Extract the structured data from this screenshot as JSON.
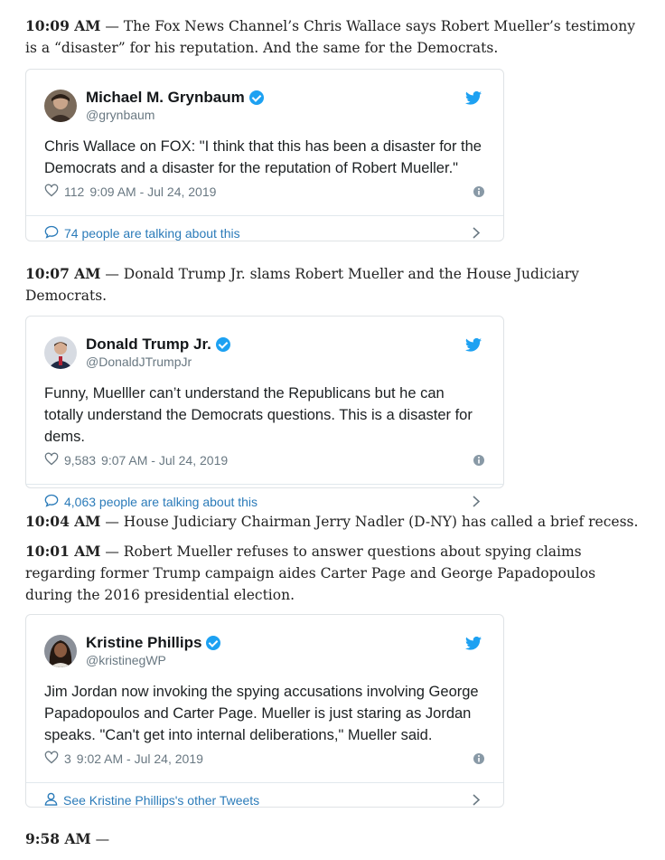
{
  "updates": [
    {
      "time": "10:09 AM",
      "text": " — The Fox News Channel’s Chris Wallace says Robert Mueller’s testimony is a “disaster” for his reputation. And the same for the Democrats."
    },
    {
      "time": "10:07 AM",
      "text": " — Donald Trump Jr. slams Robert Mueller and the House Judiciary Democrats."
    },
    {
      "time": "10:04 AM",
      "text": " — House Judiciary Chairman Jerry Nadler (D-NY) has called a brief recess."
    },
    {
      "time": "10:01 AM",
      "text": " — Robert Mueller refuses to answer questions about spying claims regarding former Trump campaign aides Carter Page and George Papadopoulos during the 2016 presidential election."
    },
    {
      "time": "9:58 AM",
      "text": " —"
    }
  ],
  "tweets": [
    {
      "name": "Michael M. Grynbaum",
      "handle": "@grynbaum",
      "text": "Chris Wallace on FOX: \"I think that this has been a disaster for the Democrats and a disaster for the reputation of Robert Mueller.\"",
      "likes": "112",
      "timestamp": "9:09 AM - Jul 24, 2019",
      "footer": "74 people are talking about this",
      "footer_icon": "comment-icon",
      "avatar_color": "#4a3a2c"
    },
    {
      "name": "Donald Trump Jr.",
      "handle": "@DonaldJTrumpJr",
      "text": "Funny, Muelller can’t understand the Republicans but he can totally understand the Democrats questions. This is a disaster for dems.",
      "likes": "9,583",
      "timestamp": "9:07 AM - Jul 24, 2019",
      "footer": "4,063 people are talking about this",
      "footer_icon": "comment-icon",
      "avatar_color": "#2d3550"
    },
    {
      "name": "Kristine Phillips",
      "handle": "@kristinegWP",
      "text": "Jim Jordan now invoking the spying accusations involving George Papadopoulos and Carter Page. Mueller is just staring as Jordan speaks. \"Can't get into internal deliberations,\" Mueller said.",
      "likes": "3",
      "timestamp": "9:02 AM - Jul 24, 2019",
      "footer": "See Kristine Phillips's other Tweets",
      "footer_icon": "person-icon",
      "avatar_color": "#3b2a24"
    }
  ],
  "colors": {
    "twitter_blue": "#1da1f2",
    "link": "#2b7bb9",
    "meta": "#697882"
  }
}
